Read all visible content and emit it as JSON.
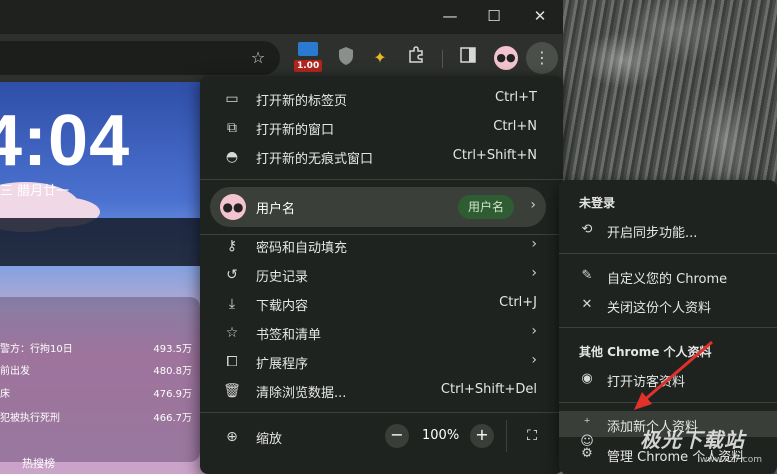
{
  "window": {
    "minimize": "—",
    "maximize": "☐",
    "close": "✕"
  },
  "toolbar": {
    "star_icon": "star-icon",
    "badge_count": "1.00",
    "icons": [
      "ublock-icon",
      "extension-icon",
      "puzzle-icon",
      "sidepanel-icon",
      "avatar-icon",
      "menu-icon"
    ]
  },
  "newtab": {
    "clock": "4:04",
    "date": "三  腊月廿一",
    "hot_list": [
      {
        "title": "警方：行拘10日",
        "count": "493.5万"
      },
      {
        "title": "前出发",
        "count": "480.8万"
      },
      {
        "title": "床",
        "count": "476.9万"
      },
      {
        "title": "犯被执行死刑",
        "count": "466.7万"
      }
    ],
    "hot_footer": "热搜榜"
  },
  "menu": {
    "new_tab": {
      "label": "打开新的标签页",
      "shortcut": "Ctrl+T"
    },
    "new_window": {
      "label": "打开新的窗口",
      "shortcut": "Ctrl+N"
    },
    "incognito": {
      "label": "打开新的无痕式窗口",
      "shortcut": "Ctrl+Shift+N"
    },
    "profile": {
      "name": "用户名",
      "chip": "用户名"
    },
    "passwords": {
      "label": "密码和自动填充"
    },
    "history": {
      "label": "历史记录"
    },
    "downloads": {
      "label": "下载内容",
      "shortcut": "Ctrl+J"
    },
    "bookmarks": {
      "label": "书签和清单"
    },
    "extensions": {
      "label": "扩展程序"
    },
    "clear_data": {
      "label": "清除浏览数据...",
      "shortcut": "Ctrl+Shift+Del"
    },
    "zoom": {
      "label": "缩放",
      "value": "100%",
      "minus": "−",
      "plus": "+"
    }
  },
  "submenu": {
    "not_signed_in": "未登录",
    "sync": "开启同步功能...",
    "customize": "自定义您的 Chrome",
    "close_profile": "关闭这份个人资料",
    "other_profiles": "其他 Chrome 个人资料",
    "guest": "打开访客资料",
    "add_profile": "添加新个人资料",
    "manage_profiles": "管理 Chrome 个人资料"
  },
  "watermark": {
    "text": "极光下载站",
    "url": "www.xz7.com"
  },
  "colors": {
    "menu_bg": "#1f231f",
    "profile_chip": "#2f5c33",
    "arrow": "#e0312b"
  }
}
